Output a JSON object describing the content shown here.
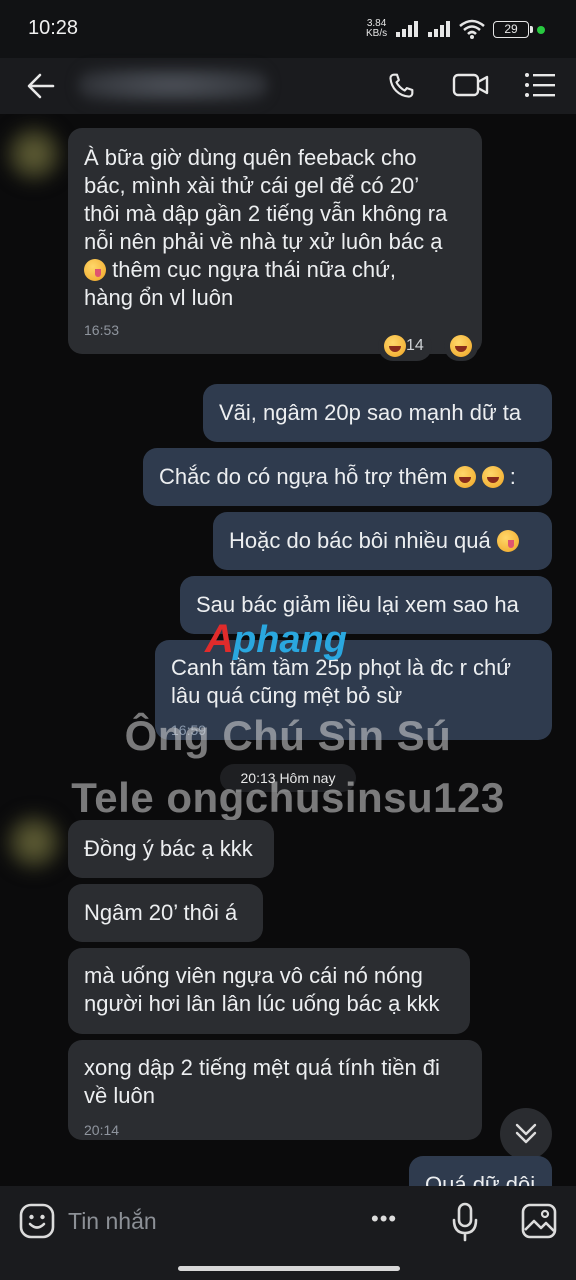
{
  "status_bar": {
    "time": "10:28",
    "net_speed_value": "3.84",
    "net_speed_unit": "KB/s",
    "battery": "29"
  },
  "header": {
    "contact_name_blurred": true
  },
  "messages": [
    {
      "direction": "in",
      "lines": [
        "À bữa giờ dùng quên feeback cho",
        "bác, mình xài thử cái gel để có 20’",
        "thôi mà dập gần 2 tiếng vẫn không ra",
        "nỗi nên phải về nhà tự xử luôn bác ạ",
        "thêm cục ngựa thái nữa chứ,",
        "hàng ổn vl luôn"
      ],
      "time": "16:53"
    },
    {
      "direction": "out",
      "text": "Vãi, ngâm 20p sao mạnh dữ ta"
    },
    {
      "direction": "out",
      "text": "Chắc do có ngựa hỗ trợ thêm",
      "suffix": ":"
    },
    {
      "direction": "out",
      "text": "Hoặc do bác bôi nhiều quá"
    },
    {
      "direction": "out",
      "text": "Sau bác giảm liều lại xem sao ha"
    },
    {
      "direction": "out",
      "lines": [
        "Canh tầm tầm 25p phọt là đc r chứ",
        "lâu quá cũng mệt bỏ sừ"
      ],
      "time": "16:59"
    },
    {
      "direction": "in",
      "text": "Đồng ý bác ạ kkk"
    },
    {
      "direction": "in",
      "text": "Ngâm 20’ thôi á"
    },
    {
      "direction": "in",
      "lines": [
        "mà uống viên ngựa vô cái nó nóng",
        "người hơi lân lân lúc uống bác ạ kkk"
      ]
    },
    {
      "direction": "in",
      "lines": [
        "xong dập 2 tiếng mệt quá tính tiền đi",
        "về luôn"
      ],
      "time": "20:14"
    },
    {
      "direction": "out",
      "text": "Quá dữ dội"
    }
  ],
  "reactions": {
    "count": "14"
  },
  "date_divider": "20:13 Hôm nay",
  "watermark": {
    "logo_text": "Aphang",
    "line1": "Ông Chú Sìn Sú",
    "line2": "Tele ongchusinsu123"
  },
  "input": {
    "placeholder": "Tin nhắn",
    "more_label": "•••"
  },
  "colors": {
    "incoming_bubble": "#2b2d31",
    "outgoing_bubble": "#2f3b4e",
    "background": "#0b0b0c",
    "logo_red": "#e02b2b",
    "logo_blue": "#2aa7df"
  },
  "icons": [
    "back-arrow-icon",
    "phone-icon",
    "video-call-icon",
    "menu-list-icon",
    "sticker-icon",
    "more-icon",
    "microphone-icon",
    "image-icon",
    "scroll-down-icon"
  ]
}
